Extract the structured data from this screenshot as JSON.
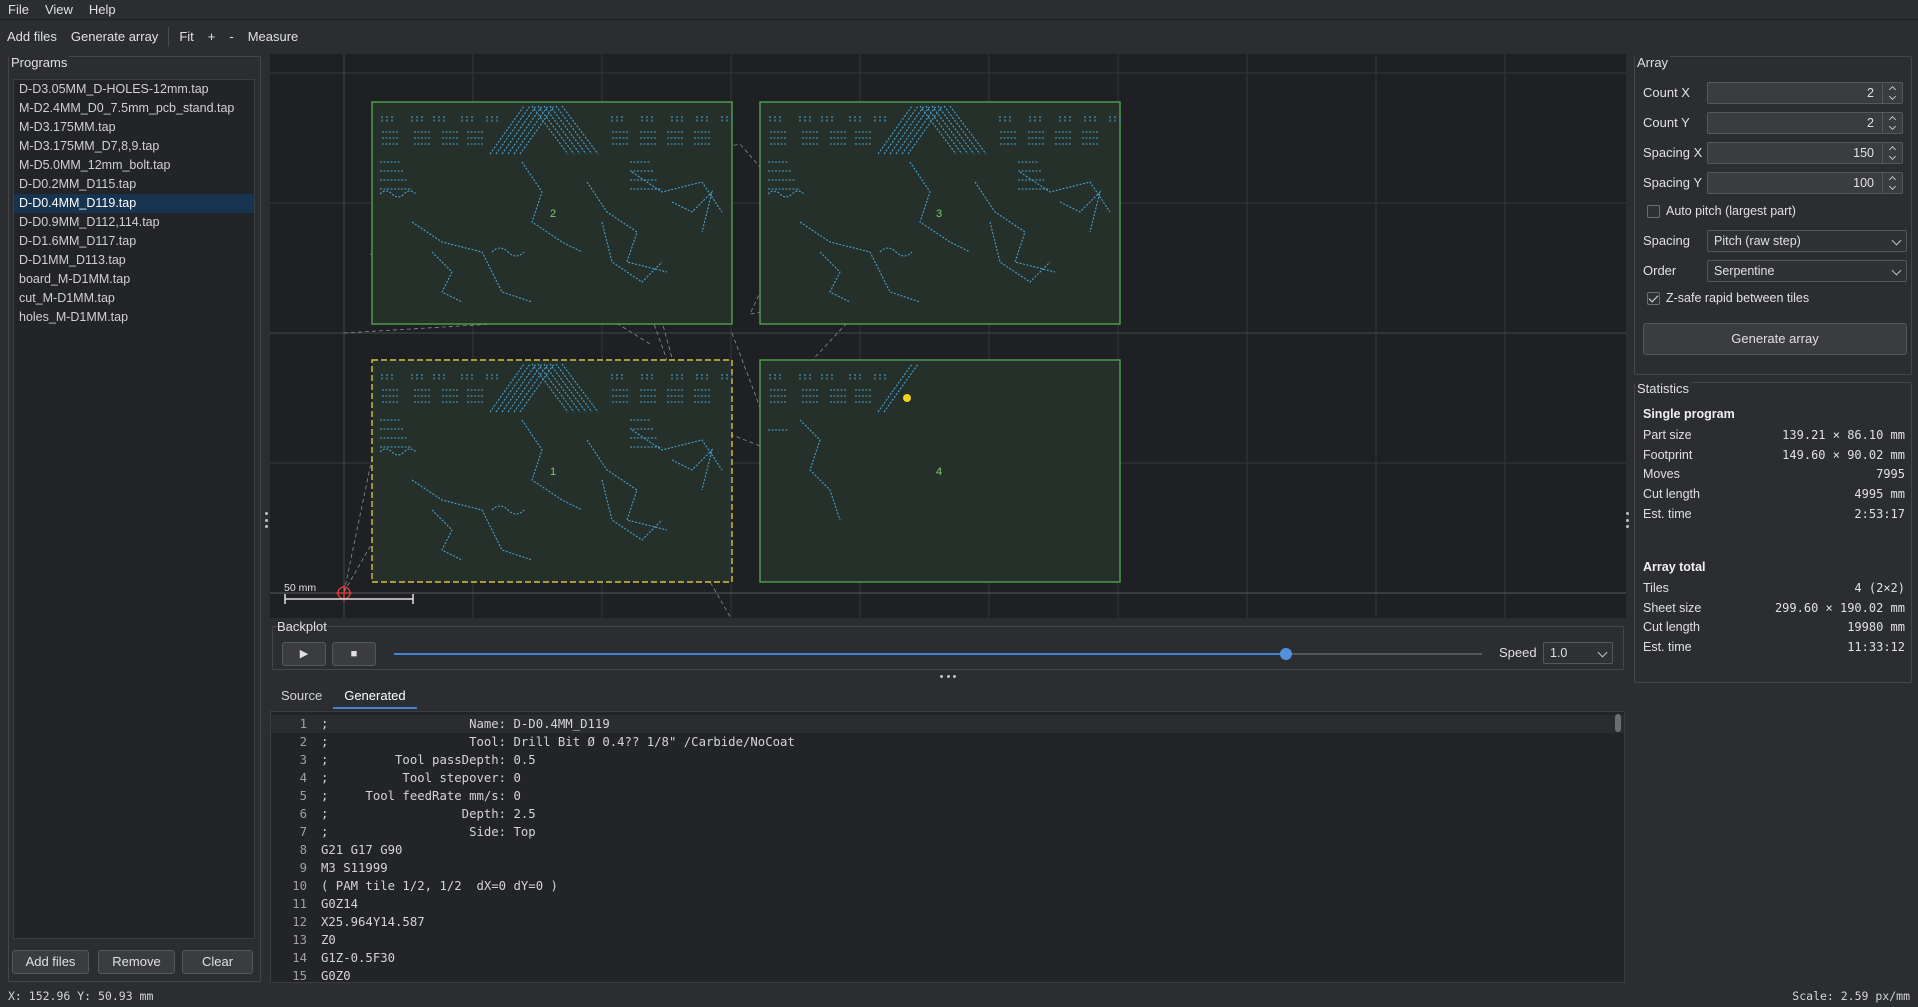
{
  "menu": [
    "File",
    "View",
    "Help"
  ],
  "toolbar": {
    "add_files": "Add files",
    "generate_array": "Generate array",
    "fit": "Fit",
    "zoom_in": "+",
    "zoom_out": "-",
    "measure": "Measure"
  },
  "programs": {
    "title": "Programs",
    "items": [
      "D-D3.05MM_D-HOLES-12mm.tap",
      "M-D2.4MM_D0_7.5mm_pcb_stand.tap",
      "M-D3.175MM.tap",
      "M-D3.175MM_D7,8,9.tap",
      "M-D5.0MM_12mm_bolt.tap",
      "D-D0.2MM_D115.tap",
      "D-D0.4MM_D119.tap",
      "D-D0.9MM_D112,114.tap",
      "D-D1.6MM_D117.tap",
      "D-D1MM_D113.tap",
      "board_M-D1MM.tap",
      "cut_M-D1MM.tap",
      "holes_M-D1MM.tap"
    ],
    "selected_index": 6,
    "buttons": {
      "add": "Add files",
      "remove": "Remove",
      "clear": "Clear"
    }
  },
  "viewport": {
    "tiles": [
      {
        "label": "2",
        "state": "complete"
      },
      {
        "label": "3",
        "state": "complete"
      },
      {
        "label": "1",
        "state": "active"
      },
      {
        "label": "4",
        "state": "partial"
      }
    ],
    "scale_bar_label": "50 mm",
    "colors": {
      "background": "#1f2023",
      "grid": "#34363a",
      "tile_fill": "#25302a",
      "tile_border": "#4fa24f",
      "active_border": "#d9c23a",
      "toolpath": "#4aa0cf",
      "rapid": "#8a8c90",
      "origin": "#e04040",
      "cursor": "#f5d020"
    }
  },
  "backplot": {
    "title": "Backplot",
    "play_icon": "▶",
    "stop_icon": "■",
    "progress": 0.82,
    "speed_label": "Speed",
    "speed_value": "1.0"
  },
  "tabs": {
    "source": "Source",
    "generated": "Generated"
  },
  "code": [
    ";                   Name: D-D0.4MM_D119",
    ";                   Tool: Drill Bit Ø 0.4?? 1/8\" /Carbide/NoCoat",
    ";         Tool passDepth: 0.5",
    ";          Tool stepover: 0",
    ";     Tool feedRate mm/s: 0",
    ";                  Depth: 2.5",
    ";                   Side: Top",
    "G21 G17 G90",
    "M3 S11999",
    "( PAM tile 1/2, 1/2  dX=0 dY=0 )",
    "G0Z14",
    "X25.964Y14.587",
    "Z0",
    "G1Z-0.5F30",
    "G0Z0"
  ],
  "array": {
    "title": "Array",
    "count_x_label": "Count X",
    "count_x": "2",
    "count_y_label": "Count Y",
    "count_y": "2",
    "spacing_x_label": "Spacing X",
    "spacing_x": "150",
    "spacing_y_label": "Spacing Y",
    "spacing_y": "100",
    "auto_pitch_label": "Auto pitch (largest part)",
    "auto_pitch": false,
    "spacing_label": "Spacing",
    "spacing_value": "Pitch (raw step)",
    "order_label": "Order",
    "order_value": "Serpentine",
    "zsafe_label": "Z-safe rapid between tiles",
    "zsafe": true,
    "generate_label": "Generate array"
  },
  "statistics": {
    "title": "Statistics",
    "single_title": "Single program",
    "single": [
      {
        "k": "Part size",
        "v": "139.21 × 86.10 mm"
      },
      {
        "k": "Footprint",
        "v": "149.60 × 90.02 mm"
      },
      {
        "k": "Moves",
        "v": "7995"
      },
      {
        "k": "Cut length",
        "v": "4995 mm"
      },
      {
        "k": "Est. time",
        "v": "2:53:17"
      }
    ],
    "total_title": "Array total",
    "total": [
      {
        "k": "Tiles",
        "v": "4  (2×2)"
      },
      {
        "k": "Sheet size",
        "v": "299.60 × 190.02 mm"
      },
      {
        "k": "Cut length",
        "v": "19980 mm"
      },
      {
        "k": "Est. time",
        "v": "11:33:12"
      }
    ]
  },
  "status": {
    "coords": "X: 152.96   Y: 50.93 mm",
    "scale": "Scale: 2.59 px/mm"
  }
}
